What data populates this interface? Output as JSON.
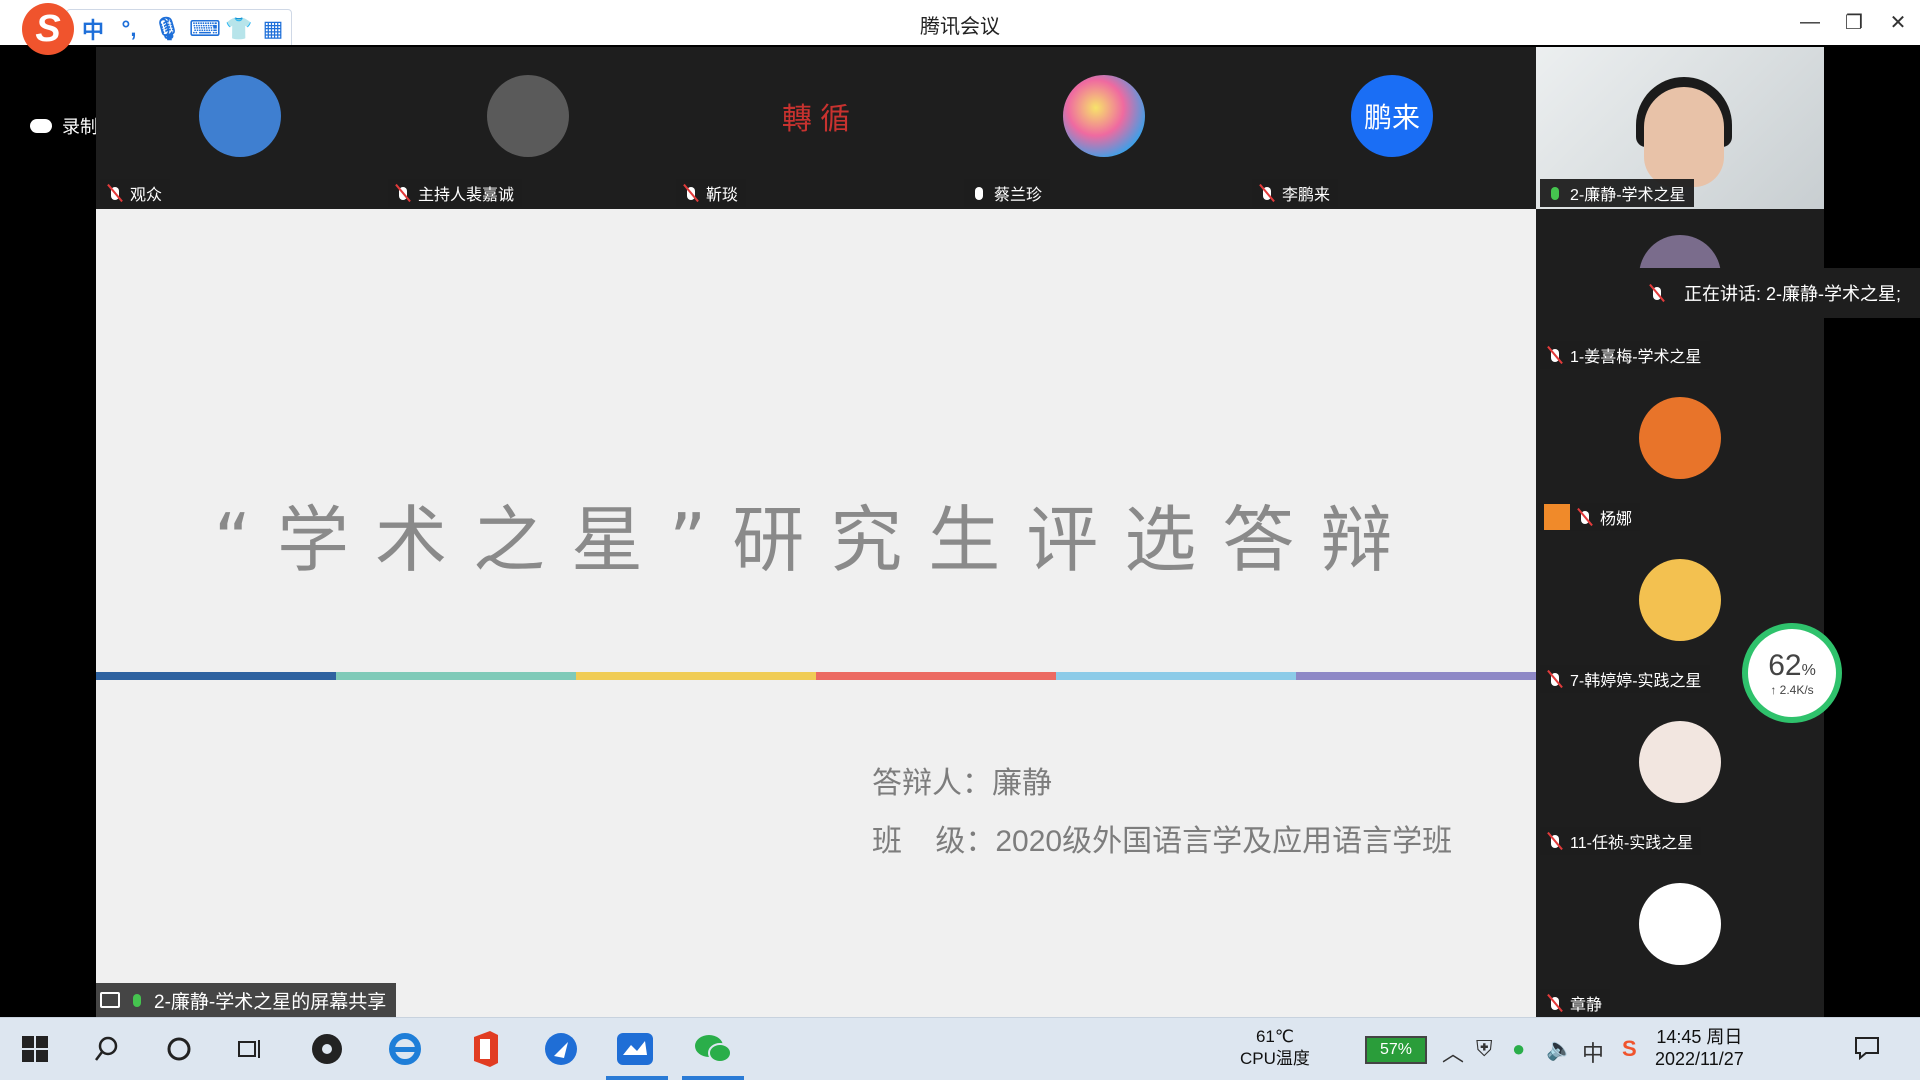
{
  "window": {
    "title": "腾讯会议",
    "minimize": "—",
    "restore": "❐",
    "close": "✕"
  },
  "ime": {
    "logo": "S",
    "items": [
      "中",
      "°,",
      "🎙",
      "⌨",
      "👕",
      "▦"
    ]
  },
  "recording": "录制中",
  "participants_top": [
    {
      "name": "观众",
      "avatar_bg": "#3f7fd0"
    },
    {
      "name": "主持人裴嘉诚",
      "avatar_bg": "#5a5a5a"
    },
    {
      "name": "靳琰",
      "avatar_bg": "#1e1e1e",
      "avatar_text": "轉 循"
    },
    {
      "name": "蔡兰珍",
      "avatar_bg": "#3da0e8"
    },
    {
      "name": "李鹏来",
      "avatar_bg": "#1a6ef5",
      "avatar_text": "鹏来"
    }
  ],
  "slide": {
    "title": "“学术之星”研究生评选答辩",
    "presenter_label": "答辩人：廉静",
    "class_label": "班    级：2020级外国语言学及应用语言学班",
    "line_colors": [
      "#2e62a0",
      "#7fcab8",
      "#f0cc55",
      "#ec6a62",
      "#8ccbe8",
      "#8e88c6"
    ]
  },
  "share_tag": "2-廉静-学术之星的屏幕共享",
  "side_participants": [
    {
      "name": "2-廉静-学术之星",
      "mic": "on"
    },
    {
      "name": "1-姜喜梅-学术之星",
      "mic": "muted",
      "avatar_bg": "#7a6c8c"
    },
    {
      "name": "杨娜",
      "mic": "muted",
      "avatar_bg": "#e8742a"
    },
    {
      "name": "7-韩婷婷-实践之星",
      "mic": "muted",
      "avatar_bg": "#f3c150"
    },
    {
      "name": "11-任祯-实践之星",
      "mic": "muted",
      "avatar_bg": "#f2e6e0"
    },
    {
      "name": "章静",
      "mic": "muted",
      "avatar_bg": "#ffffff"
    }
  ],
  "speaking": "正在讲话: 2-廉静-学术之星;",
  "network": {
    "percent": "62",
    "unit": "%",
    "speed": "↑ 2.4K/s"
  },
  "taskbar": {
    "cpu_temp": "61℃",
    "cpu_label": "CPU温度",
    "battery": "57%",
    "time": "14:45 周日",
    "date": "2022/11/27",
    "ime_indicator": "中"
  }
}
